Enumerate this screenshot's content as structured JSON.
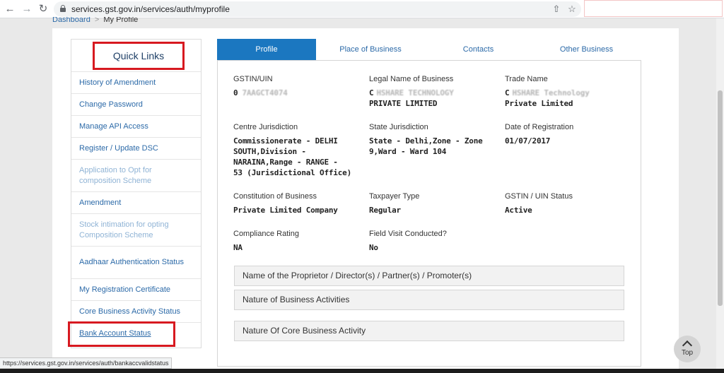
{
  "browser": {
    "url": "services.gst.gov.in/services/auth/myprofile",
    "back_icon": "arrow-left-icon",
    "forward_icon": "arrow-right-icon",
    "reload_icon": "reload-icon",
    "share_icon": "share-icon",
    "bookmark_icon": "star-icon"
  },
  "breadcrumb": {
    "link": "Dashboard",
    "separator": ">",
    "current": "My Profile"
  },
  "quick_links": {
    "title": "Quick Links",
    "items": [
      {
        "label": "History of Amendment",
        "enabled": true
      },
      {
        "label": "Change Password",
        "enabled": true
      },
      {
        "label": "Manage API Access",
        "enabled": true
      },
      {
        "label": "Register / Update DSC",
        "enabled": true
      },
      {
        "label": "Application to Opt for composition Scheme",
        "enabled": false
      },
      {
        "label": "Amendment",
        "enabled": true
      },
      {
        "label": "Stock intimation for opting Composition Scheme",
        "enabled": false
      },
      {
        "label": "Aadhaar Authentication Status",
        "enabled": true
      },
      {
        "label": "My Registration Certificate",
        "enabled": true
      },
      {
        "label": "Core Business Activity Status",
        "enabled": true
      },
      {
        "label": "Bank Account Status",
        "enabled": true
      }
    ]
  },
  "tabs": [
    {
      "label": "Profile",
      "active": true
    },
    {
      "label": "Place of Business",
      "active": false
    },
    {
      "label": "Contacts",
      "active": false
    },
    {
      "label": "Other Business",
      "active": false
    }
  ],
  "profile": {
    "gstin_label": "GSTIN/UIN",
    "gstin_value": "0",
    "gstin_value_hidden": "7AAGCT4074",
    "legal_name_label": "Legal Name of Business",
    "legal_name_line1": "C",
    "legal_name_line1_hidden": "HSHARE TECHNOLOGY",
    "legal_name_line2": "PRIVATE LIMITED",
    "trade_name_label": "Trade Name",
    "trade_name_line1": "C",
    "trade_name_line1_hidden": "HSHARE Technology",
    "trade_name_line2": "Private Limited",
    "centre_label": "Centre Jurisdiction",
    "centre_lines": [
      "Commissionerate - DELHI",
      "SOUTH,Division -",
      "NARAINA,Range - RANGE -",
      "53 (Jurisdictional Office)"
    ],
    "state_label": "State Jurisdiction",
    "state_lines": [
      "State - Delhi,Zone - Zone",
      "9,Ward - Ward 104"
    ],
    "reg_date_label": "Date of Registration",
    "reg_date_value": "01/07/2017",
    "constitution_label": "Constitution of Business",
    "constitution_value": "Private Limited Company",
    "taxpayer_label": "Taxpayer Type",
    "taxpayer_value": "Regular",
    "status_label": "GSTIN / UIN Status",
    "status_value": "Active",
    "compliance_label": "Compliance Rating",
    "compliance_value": "NA",
    "visit_label": "Field Visit Conducted?",
    "visit_value": "No"
  },
  "accordions": [
    "Name of the Proprietor / Director(s) / Partner(s) / Promoter(s)",
    "Nature of Business Activities",
    "Nature Of Core Business Activity"
  ],
  "status_bar": "https://services.gst.gov.in/services/auth/bankaccvalidstatus",
  "top_button": {
    "label": "Top",
    "icon": "chevron-up-icon"
  },
  "colors": {
    "accent": "#1b77c0",
    "link": "#2c6aa8",
    "highlight": "#d71920"
  }
}
